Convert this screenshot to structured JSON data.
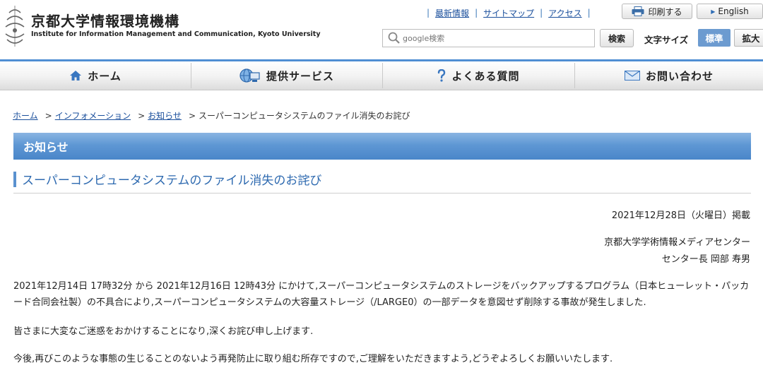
{
  "site": {
    "title": "京都大学情報環境機構",
    "subtitle": "Institute for Information Management and Communication, Kyoto University"
  },
  "toplinks": [
    "最新情報",
    "サイトマップ",
    "アクセス"
  ],
  "buttons": {
    "print": "印刷する",
    "english": "English",
    "search": "検索"
  },
  "search": {
    "placeholder": "google検索"
  },
  "font_size": {
    "label": "文字サイズ",
    "standard": "標準",
    "large": "拡大"
  },
  "nav": {
    "home": "ホーム",
    "services": "提供サービス",
    "faq": "よくある質問",
    "contact": "お問い合わせ"
  },
  "breadcrumb": {
    "home": "ホーム",
    "info": "インフォメーション",
    "news": "お知らせ",
    "current": "スーパーコンピュータシステムのファイル消失のお詫び"
  },
  "section": {
    "title": "お知らせ"
  },
  "article": {
    "title": "スーパーコンピュータシステムのファイル消失のお詫び",
    "date": "2021年12月28日（火曜日）掲載",
    "org": "京都大学学術情報メディアセンター",
    "author": "センター長 岡部 寿男",
    "p1": "2021年12月14日 17時32分 から 2021年12月16日 12時43分 にかけて,スーパーコンピュータシステムのストレージをバックアップするプログラム（日本ヒューレット・パッカード合同会社製）の不具合により,スーパーコンピュータシステムの大容量ストレージ（/LARGE0）の一部データを意図せず削除する事故が発生しました.",
    "p2": "皆さまに大変なご迷惑をおかけすることになり,深くお詫び申し上げます.",
    "p3": "今後,再びこのような事態の生じることのないよう再発防止に取り組む所存ですので,ご理解をいただきますよう,どうぞよろしくお願いいたします."
  },
  "colors": {
    "accent": "#4f8ed3",
    "link": "#1a4f9c",
    "title": "#2e6ab0"
  }
}
